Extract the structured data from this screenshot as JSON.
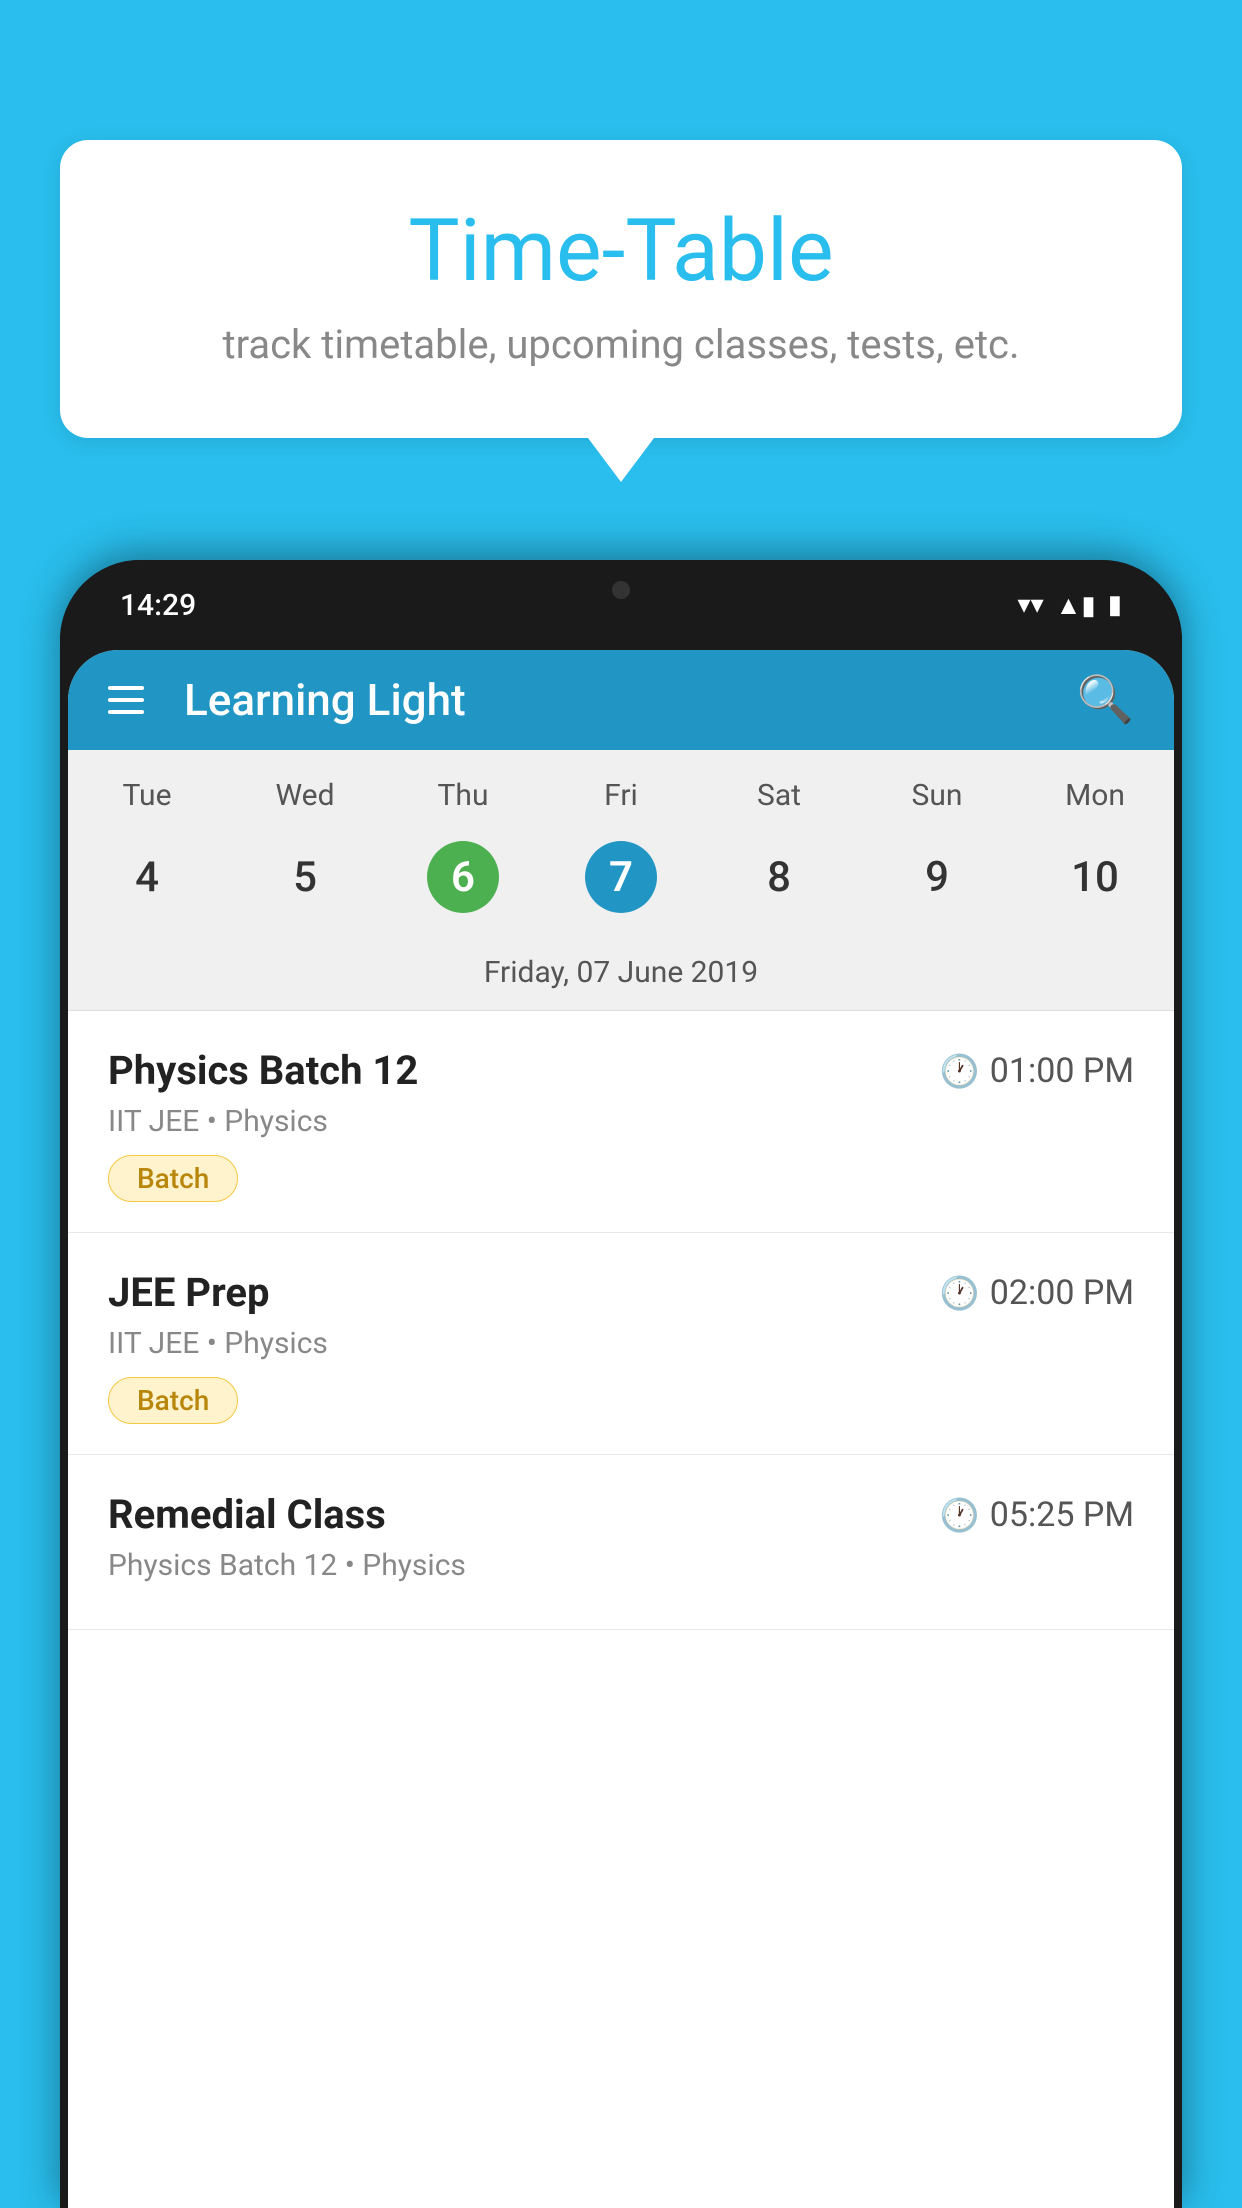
{
  "background_color": "#29BEED",
  "speech_bubble": {
    "title": "Time-Table",
    "subtitle": "track timetable, upcoming classes, tests, etc."
  },
  "phone": {
    "status_bar": {
      "time": "14:29",
      "wifi": "▼",
      "signal": "▲",
      "battery": "▮"
    },
    "app_bar": {
      "title": "Learning Light",
      "menu_icon": "menu",
      "search_icon": "search"
    },
    "calendar": {
      "days": [
        {
          "abbr": "Tue",
          "num": "4"
        },
        {
          "abbr": "Wed",
          "num": "5"
        },
        {
          "abbr": "Thu",
          "num": "6",
          "state": "today"
        },
        {
          "abbr": "Fri",
          "num": "7",
          "state": "selected"
        },
        {
          "abbr": "Sat",
          "num": "8"
        },
        {
          "abbr": "Sun",
          "num": "9"
        },
        {
          "abbr": "Mon",
          "num": "10"
        }
      ],
      "selected_date_label": "Friday, 07 June 2019"
    },
    "schedule": [
      {
        "title": "Physics Batch 12",
        "time": "01:00 PM",
        "subtitle": "IIT JEE • Physics",
        "tag": "Batch"
      },
      {
        "title": "JEE Prep",
        "time": "02:00 PM",
        "subtitle": "IIT JEE • Physics",
        "tag": "Batch"
      },
      {
        "title": "Remedial Class",
        "time": "05:25 PM",
        "subtitle": "Physics Batch 12 • Physics",
        "tag": ""
      }
    ]
  }
}
